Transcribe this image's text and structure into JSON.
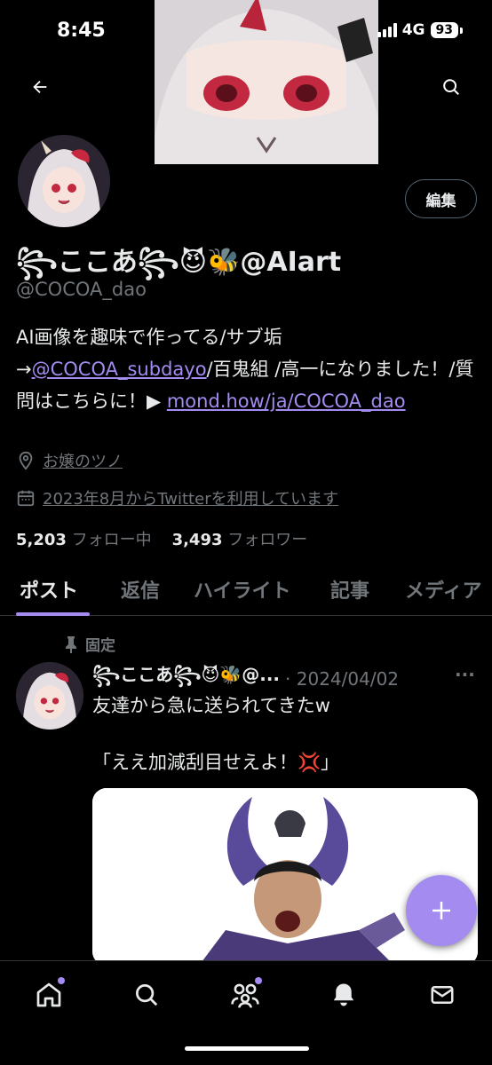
{
  "status": {
    "time": "8:45",
    "network": "4G",
    "battery": "93"
  },
  "profile": {
    "display_name": "꧂ここあ꧂😈🐝@AIart",
    "handle": "@COCOA_dao",
    "edit_label": "編集",
    "bio_text_1": " AI画像を趣味で作ってる/サブ垢→",
    "bio_link_1": "@COCOA_subdayo",
    "bio_text_2": "/百鬼組 /高一になりました！/質問はこちらに！▶ ",
    "bio_link_2": "mond.how/ja/COCOA_dao",
    "location": "お嬢のツノ",
    "joined": "2023年8月からTwitterを利用しています",
    "following_count": "5,203",
    "following_label": " フォロー中",
    "followers_count": "3,493",
    "followers_label": " フォロワー"
  },
  "tabs": [
    "ポスト",
    "返信",
    "ハイライト",
    "記事",
    "メディア"
  ],
  "post": {
    "pinned_label": "固定",
    "author": "꧂ここあ꧂😈🐝@...",
    "date": "· 2024/04/02",
    "more": "···",
    "line1": "友達から急に送られてきたw",
    "line2": "「ええ加減刮目せえよ！💢」"
  },
  "colors": {
    "accent": "#a48bf0",
    "muted": "#71767b",
    "text": "#e7e9ea",
    "background": "#000000"
  },
  "icons": [
    "back-arrow-icon",
    "search-icon",
    "location-icon",
    "calendar-icon",
    "pin-icon",
    "plus-icon",
    "home-icon",
    "explore-icon",
    "communities-icon",
    "notifications-icon",
    "messages-icon"
  ]
}
